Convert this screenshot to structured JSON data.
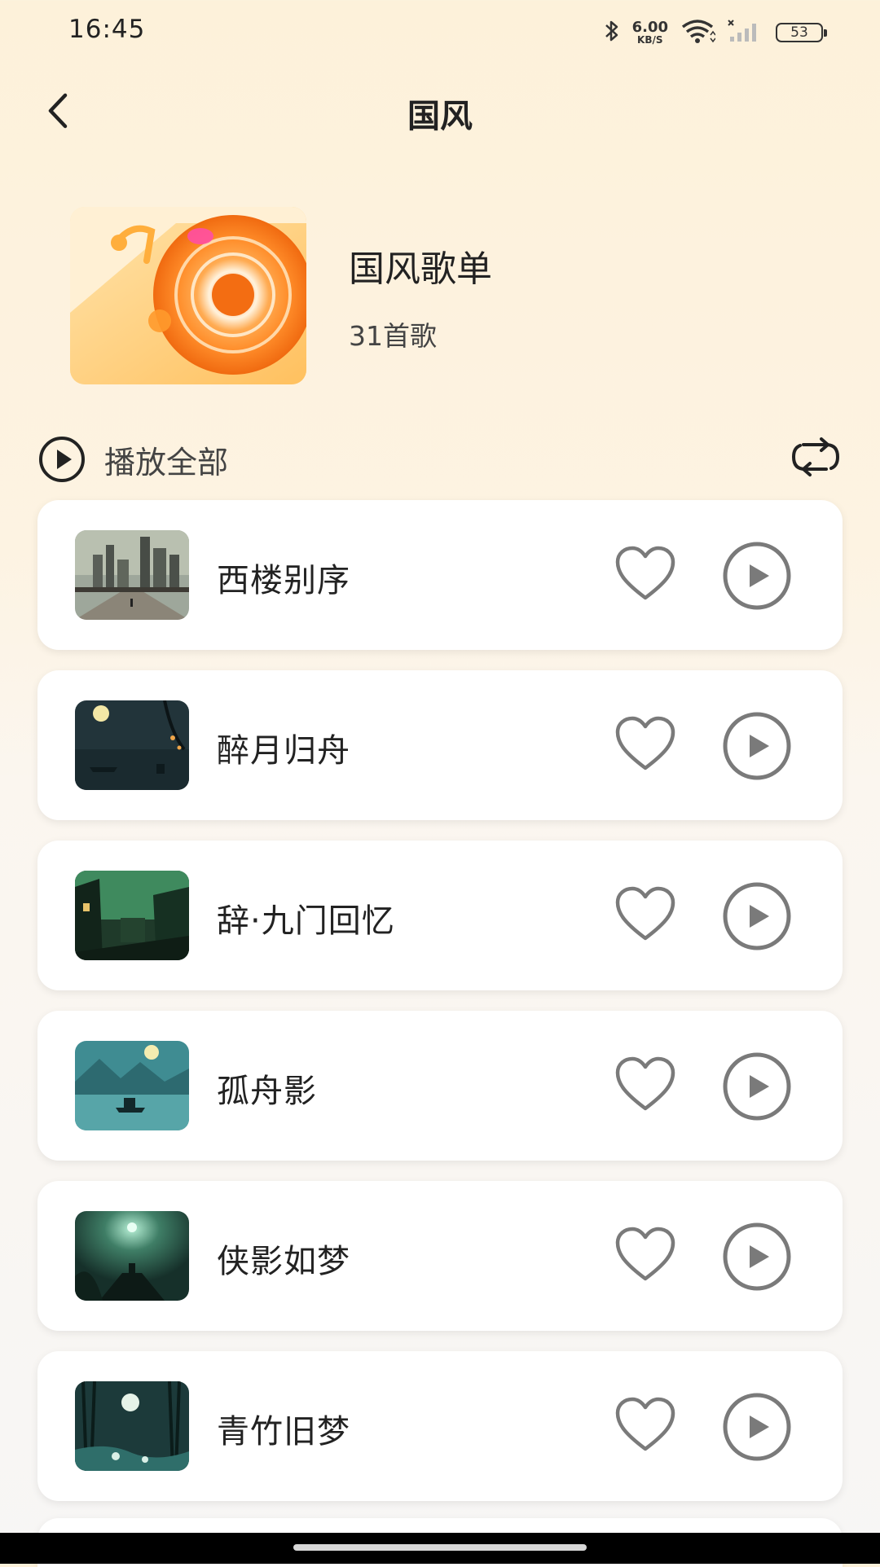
{
  "status_bar": {
    "time": "16:45",
    "net_speed_value": "6.00",
    "net_speed_unit": "KB/S",
    "battery": "53",
    "icons": [
      "bluetooth-icon",
      "wifi-icon",
      "cellular-signal-icon",
      "battery-icon"
    ]
  },
  "header": {
    "title": "国风",
    "back_icon": "chevron-left-icon"
  },
  "playlist": {
    "name": "国风歌单",
    "count_text": "31首歌"
  },
  "controls": {
    "play_all_label": "播放全部",
    "play_all_icon": "play-circle-icon",
    "loop_icon": "loop-icon"
  },
  "songs": [
    {
      "title": "西楼别序",
      "thumb_theme": "city-street"
    },
    {
      "title": "醉月归舟",
      "thumb_theme": "moon-lake-boat"
    },
    {
      "title": "辞·九门回忆",
      "thumb_theme": "green-alley"
    },
    {
      "title": "孤舟影",
      "thumb_theme": "moon-mountain-boat"
    },
    {
      "title": "侠影如梦",
      "thumb_theme": "moon-cliff-figure"
    },
    {
      "title": "青竹旧梦",
      "thumb_theme": "bamboo-moon-stream"
    }
  ],
  "colors": {
    "background_top": "#fdf1da",
    "card": "#ffffff",
    "icon_gray": "#7a7a7a",
    "text": "#222222"
  }
}
